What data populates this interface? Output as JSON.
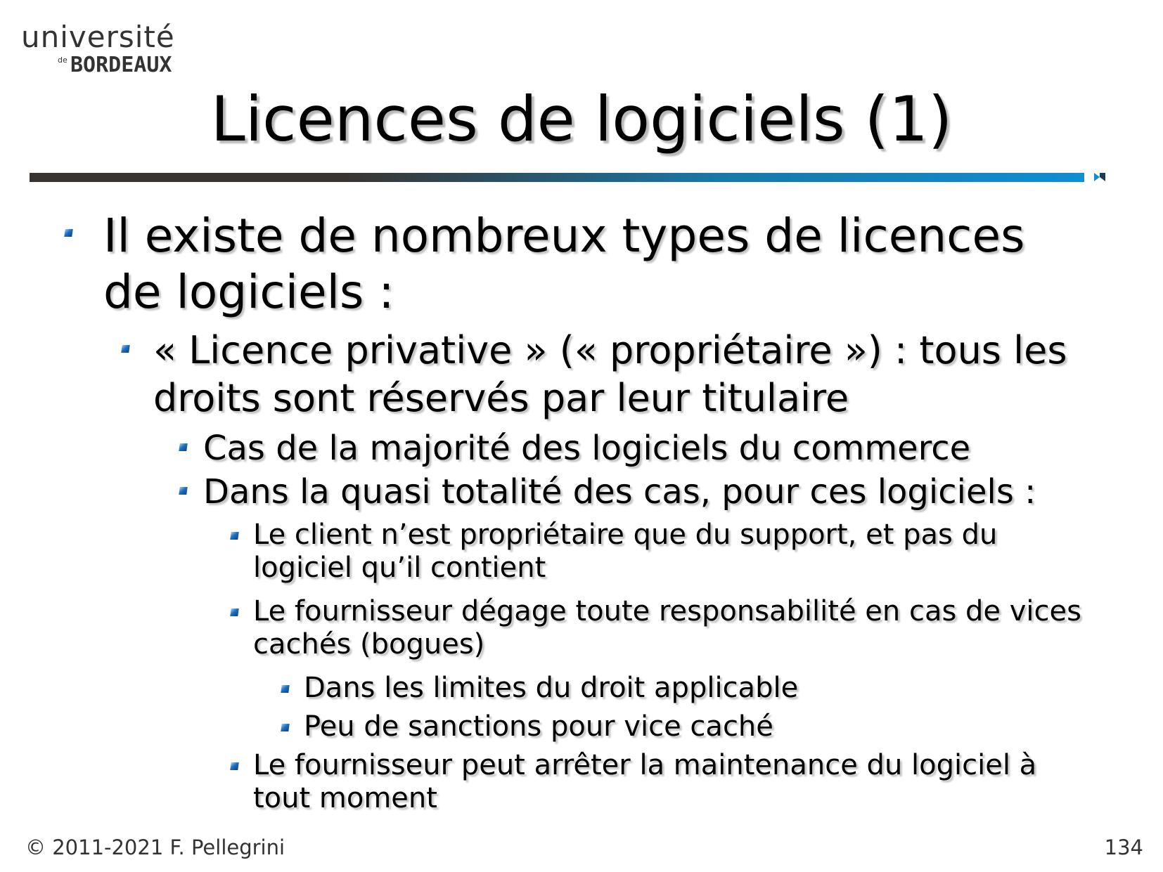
{
  "logo": {
    "line1": "université",
    "line2_small": "de",
    "line2": "BORDEAUX"
  },
  "title": "Licences de logiciels (1)",
  "bullets": [
    {
      "level": 1,
      "text": "Il existe de nombreux types de licences de logiciels :"
    },
    {
      "level": 2,
      "text": "« Licence privative » (« propriétaire ») : tous les droits sont réservés par leur titulaire"
    },
    {
      "level": 3,
      "text": "Cas de la majorité des logiciels du commerce"
    },
    {
      "level": 3,
      "text": "Dans la quasi totalité des cas, pour ces logiciels :"
    },
    {
      "level": 4,
      "text": "Le client n’est propriétaire que du support, et pas du logiciel qu’il contient"
    },
    {
      "level": 4,
      "text": "Le fournisseur dégage toute responsabilité en cas de vices cachés (bogues)"
    },
    {
      "level": 5,
      "text": "Dans les limites du droit applicable"
    },
    {
      "level": 5,
      "text": "Peu de sanctions pour vice caché"
    },
    {
      "level": 4,
      "text": "Le fournisseur peut arrêter la maintenance du logiciel à tout moment"
    }
  ],
  "footer": {
    "copyright": "© 2011-2021 F. Pellegrini",
    "page_number": "134"
  },
  "colors": {
    "accent": "#0f8ed2",
    "rule_dark": "#3a3430",
    "text": "#000000"
  }
}
